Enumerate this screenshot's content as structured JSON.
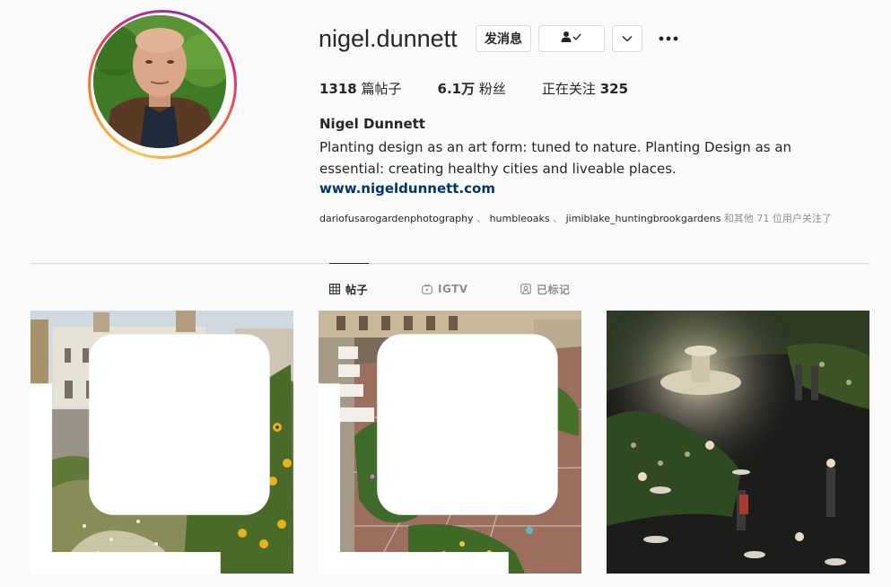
{
  "profile": {
    "username": "nigel.dunnett",
    "full_name": "Nigel Dunnett",
    "bio": "Planting design as an art form: tuned to nature. Planting Design as an essential: creating healthy cities and liveable places.",
    "website": "www.nigeldunnett.com"
  },
  "actions": {
    "message_label": "发消息",
    "follow_icon": "person-check-icon",
    "dropdown_icon": "chevron-down-icon",
    "more_icon": "more-horizontal-icon"
  },
  "stats": {
    "posts_count": "1318",
    "posts_label": "篇帖子",
    "followers_count": "6.1万",
    "followers_label": "粉丝",
    "following_label": "正在关注",
    "following_count": "325"
  },
  "followed_by": {
    "users": [
      "dariofusarogardenphotography",
      "humbleoaks",
      "jimiblake_huntingbrookgardens"
    ],
    "separator": "、",
    "suffix": "和其他 71 位用户关注了"
  },
  "tabs": [
    {
      "label": "帖子",
      "icon": "grid-icon",
      "active": true
    },
    {
      "label": "IGTV",
      "icon": "igtv-icon",
      "active": false
    },
    {
      "label": "已标记",
      "icon": "tagged-icon",
      "active": false
    }
  ],
  "posts": [
    {
      "icon": "multiple-posts-icon"
    },
    {
      "icon": "multiple-posts-icon"
    },
    {
      "icon": null
    }
  ],
  "colors": {
    "link": "#00376b",
    "border": "#dbdbdb",
    "muted": "#8e8e8e",
    "text": "#262626"
  }
}
